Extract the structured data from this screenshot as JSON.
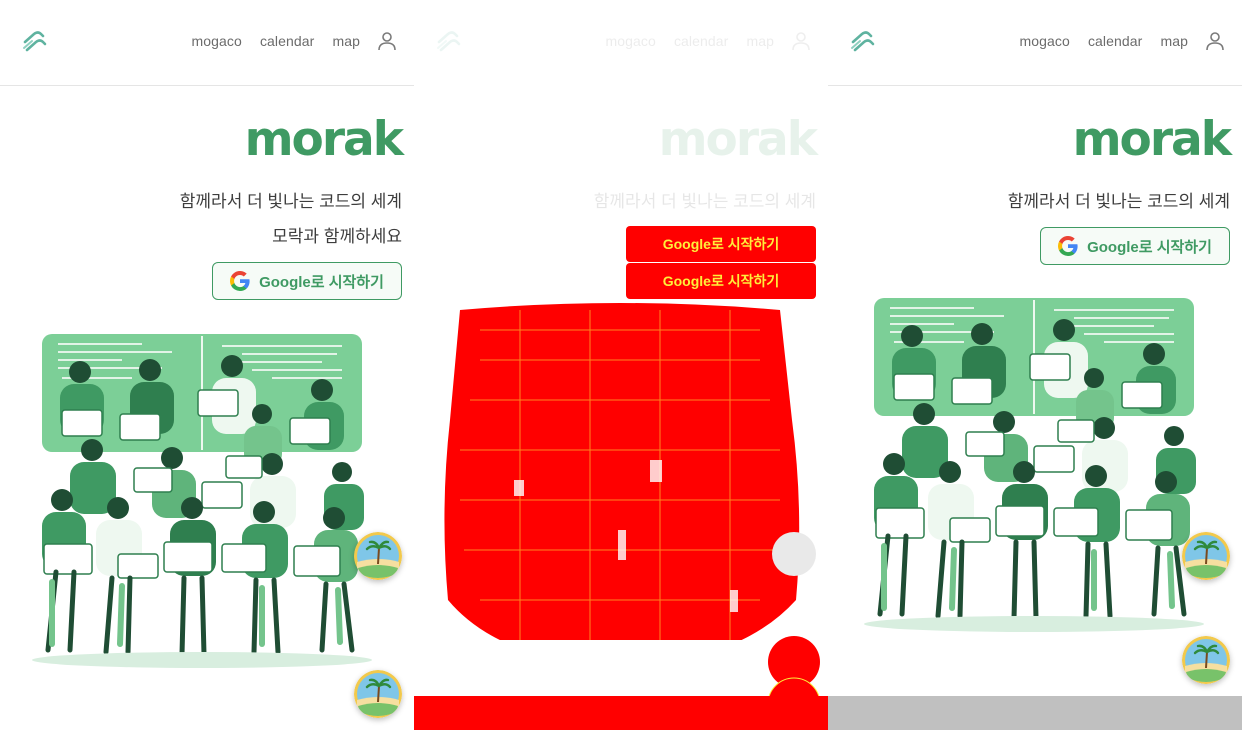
{
  "nav": {
    "items": [
      {
        "label": "mogaco"
      },
      {
        "label": "calendar"
      },
      {
        "label": "map"
      }
    ],
    "user_icon": "user-icon",
    "logo_icon": "morak-logo-icon"
  },
  "hero": {
    "brand": "morak",
    "tagline_1": "함께라서 더 빛나는 코드의 세계",
    "tagline_2": "모락과 함께하세요",
    "google_button": "Google로 시작하기",
    "google_icon": "google-g-icon",
    "illustration": "developers-group-illustration"
  },
  "floating": {
    "badge_icon": "island-palm-avatar-icon"
  },
  "colors": {
    "brand_green": "#3f9a63",
    "diff_red": "#ff0000",
    "diff_yellow": "#ffef3a",
    "text_dark": "#3d3d3d",
    "nav_gray": "#6b6b6b"
  }
}
